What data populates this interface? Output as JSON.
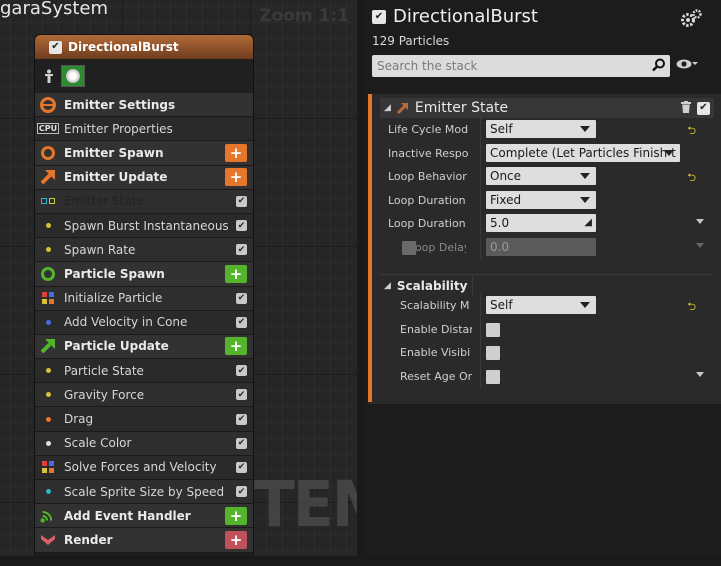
{
  "graph": {
    "title": "garaSystem",
    "zoom": "Zoom 1:1",
    "watermark": "SYSTEM"
  },
  "node": {
    "title": "DirectionalBurst",
    "rows": [
      {
        "kind": "section",
        "label": "Emitter Settings",
        "icon": "emitter-settings-icon",
        "color": "#e5762a"
      },
      {
        "kind": "item",
        "label": "Emitter Properties",
        "icon": "cpu-icon"
      },
      {
        "kind": "section",
        "label": "Emitter Spawn",
        "icon": "emitter-spawn-ring-icon",
        "color": "#e5762a",
        "add": "orange"
      },
      {
        "kind": "section",
        "label": "Emitter Update",
        "icon": "emitter-update-arrow-icon",
        "color": "#e5762a",
        "add": "orange"
      },
      {
        "kind": "item",
        "label": "Emitter State",
        "selected": true,
        "dots": [
          "#2fb5c9",
          "#c9c93a"
        ],
        "check": true
      },
      {
        "kind": "item",
        "label": "Spawn Burst Instantaneous",
        "dot": "#d9c23a",
        "check": true
      },
      {
        "kind": "item",
        "label": "Spawn Rate",
        "dot": "#d9c23a",
        "check": true
      },
      {
        "kind": "section",
        "label": "Particle Spawn",
        "icon": "particle-spawn-ring-icon",
        "color": "#54b52c",
        "add": "green"
      },
      {
        "kind": "item",
        "label": "Initialize Particle",
        "dots4": [
          "#e04040",
          "#4a6ee0",
          "#d9c23a",
          "#e5762a"
        ],
        "check": true
      },
      {
        "kind": "item",
        "label": "Add Velocity in Cone",
        "dot": "#4a6ee0",
        "check": true
      },
      {
        "kind": "section",
        "label": "Particle Update",
        "icon": "particle-update-arrow-icon",
        "color": "#54b52c",
        "add": "green"
      },
      {
        "kind": "item",
        "label": "Particle State",
        "dot": "#d9c23a",
        "check": true
      },
      {
        "kind": "item",
        "label": "Gravity Force",
        "dot": "#d9c23a",
        "check": true
      },
      {
        "kind": "item",
        "label": "Drag",
        "dot": "#e5762a",
        "check": true
      },
      {
        "kind": "item",
        "label": "Scale Color",
        "dot": "#e0e0e0",
        "check": true
      },
      {
        "kind": "item",
        "label": "Solve Forces and Velocity",
        "dots4": [
          "#e04040",
          "#4a6ee0",
          "#d9c23a",
          "#e5762a"
        ],
        "check": true
      },
      {
        "kind": "item",
        "label": "Scale Sprite Size by Speed",
        "dot": "#2fb5c9",
        "check": true
      },
      {
        "kind": "section",
        "label": "Add Event Handler",
        "icon": "event-handler-icon",
        "color": "#54b52c",
        "add": "green"
      },
      {
        "kind": "section",
        "label": "Render",
        "icon": "render-icon",
        "color": "#c0505a",
        "add": "red"
      }
    ]
  },
  "details": {
    "title": "DirectionalBurst",
    "particle_count": "129 Particles",
    "search_placeholder": "Search the stack",
    "emitter_state": {
      "title": "Emitter State",
      "props": [
        {
          "label": "Life Cycle Mod",
          "value": "Self",
          "type": "combo",
          "reset": true
        },
        {
          "label": "Inactive Respor",
          "value": "Complete (Let Particles Finish th",
          "type": "combo-wide"
        },
        {
          "label": "Loop Behavior",
          "value": "Once",
          "type": "combo",
          "reset": true
        },
        {
          "label": "Loop Duration M",
          "value": "Fixed",
          "type": "combo"
        },
        {
          "label": "Loop Duration",
          "value": "5.0",
          "type": "number",
          "expand": true
        },
        {
          "label": "Loop Delay",
          "value": "0.0",
          "type": "number-disabled",
          "expand": true
        }
      ]
    },
    "scalability": {
      "title": "Scalability",
      "props": [
        {
          "label": "Scalability M",
          "value": "Self",
          "type": "combo",
          "reset": true
        },
        {
          "label": "Enable Distar",
          "type": "check"
        },
        {
          "label": "Enable Visibi",
          "type": "check"
        },
        {
          "label": "Reset Age Or",
          "type": "check",
          "expand": true
        }
      ]
    },
    "reset_glyph": "⮌",
    "colors": {
      "accent": "#e5762a",
      "add_green": "#54b52c",
      "render_red": "#c0505a",
      "selected_row": "#d8b88e"
    }
  }
}
